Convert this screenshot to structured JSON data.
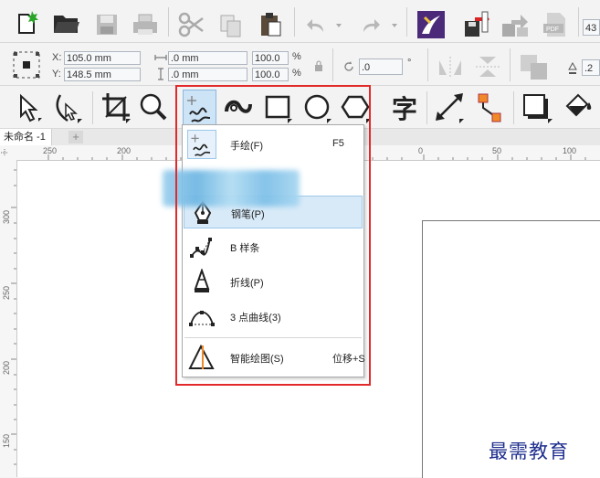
{
  "toolbar_standard": {
    "zoom_value": "43"
  },
  "property_bar": {
    "x_label": "X:",
    "x_value": "105.0 mm",
    "y_label": "Y:",
    "y_value": "148.5 mm",
    "width_value": ".0 mm",
    "height_value": ".0 mm",
    "scale_w": "100.0",
    "scale_h": "100.0",
    "percent": "%",
    "rotation_value": ".0",
    "degree": "°",
    "outline_value": ".2"
  },
  "toolbox": {
    "text_tool_glyph": "字"
  },
  "document_tab": {
    "name": "未命名 -1",
    "add": "+"
  },
  "ruler": {
    "h_labels": [
      "250",
      "200",
      "0",
      "50",
      "100"
    ],
    "v_labels": [
      "300",
      "250",
      "200",
      "150"
    ]
  },
  "flyout": {
    "items": [
      {
        "label": "手绘(F)",
        "shortcut": "F5",
        "icon": "freehand-icon"
      },
      {
        "label": "钢笔(P)",
        "shortcut": "",
        "icon": "pen-icon"
      },
      {
        "label": "B 样条",
        "shortcut": "",
        "icon": "bspline-icon"
      },
      {
        "label": "折线(P)",
        "shortcut": "",
        "icon": "polyline-icon"
      },
      {
        "label": "3 点曲线(3)",
        "shortcut": "",
        "icon": "three-point-curve-icon"
      },
      {
        "label": "智能绘图(S)",
        "shortcut": "位移+S",
        "icon": "smart-drawing-icon"
      }
    ]
  },
  "watermark": "最需教育",
  "colors": {
    "highlight_border": "#e32a2a",
    "selection": "#d8eaf8",
    "watermark": "#1f2f8f"
  }
}
